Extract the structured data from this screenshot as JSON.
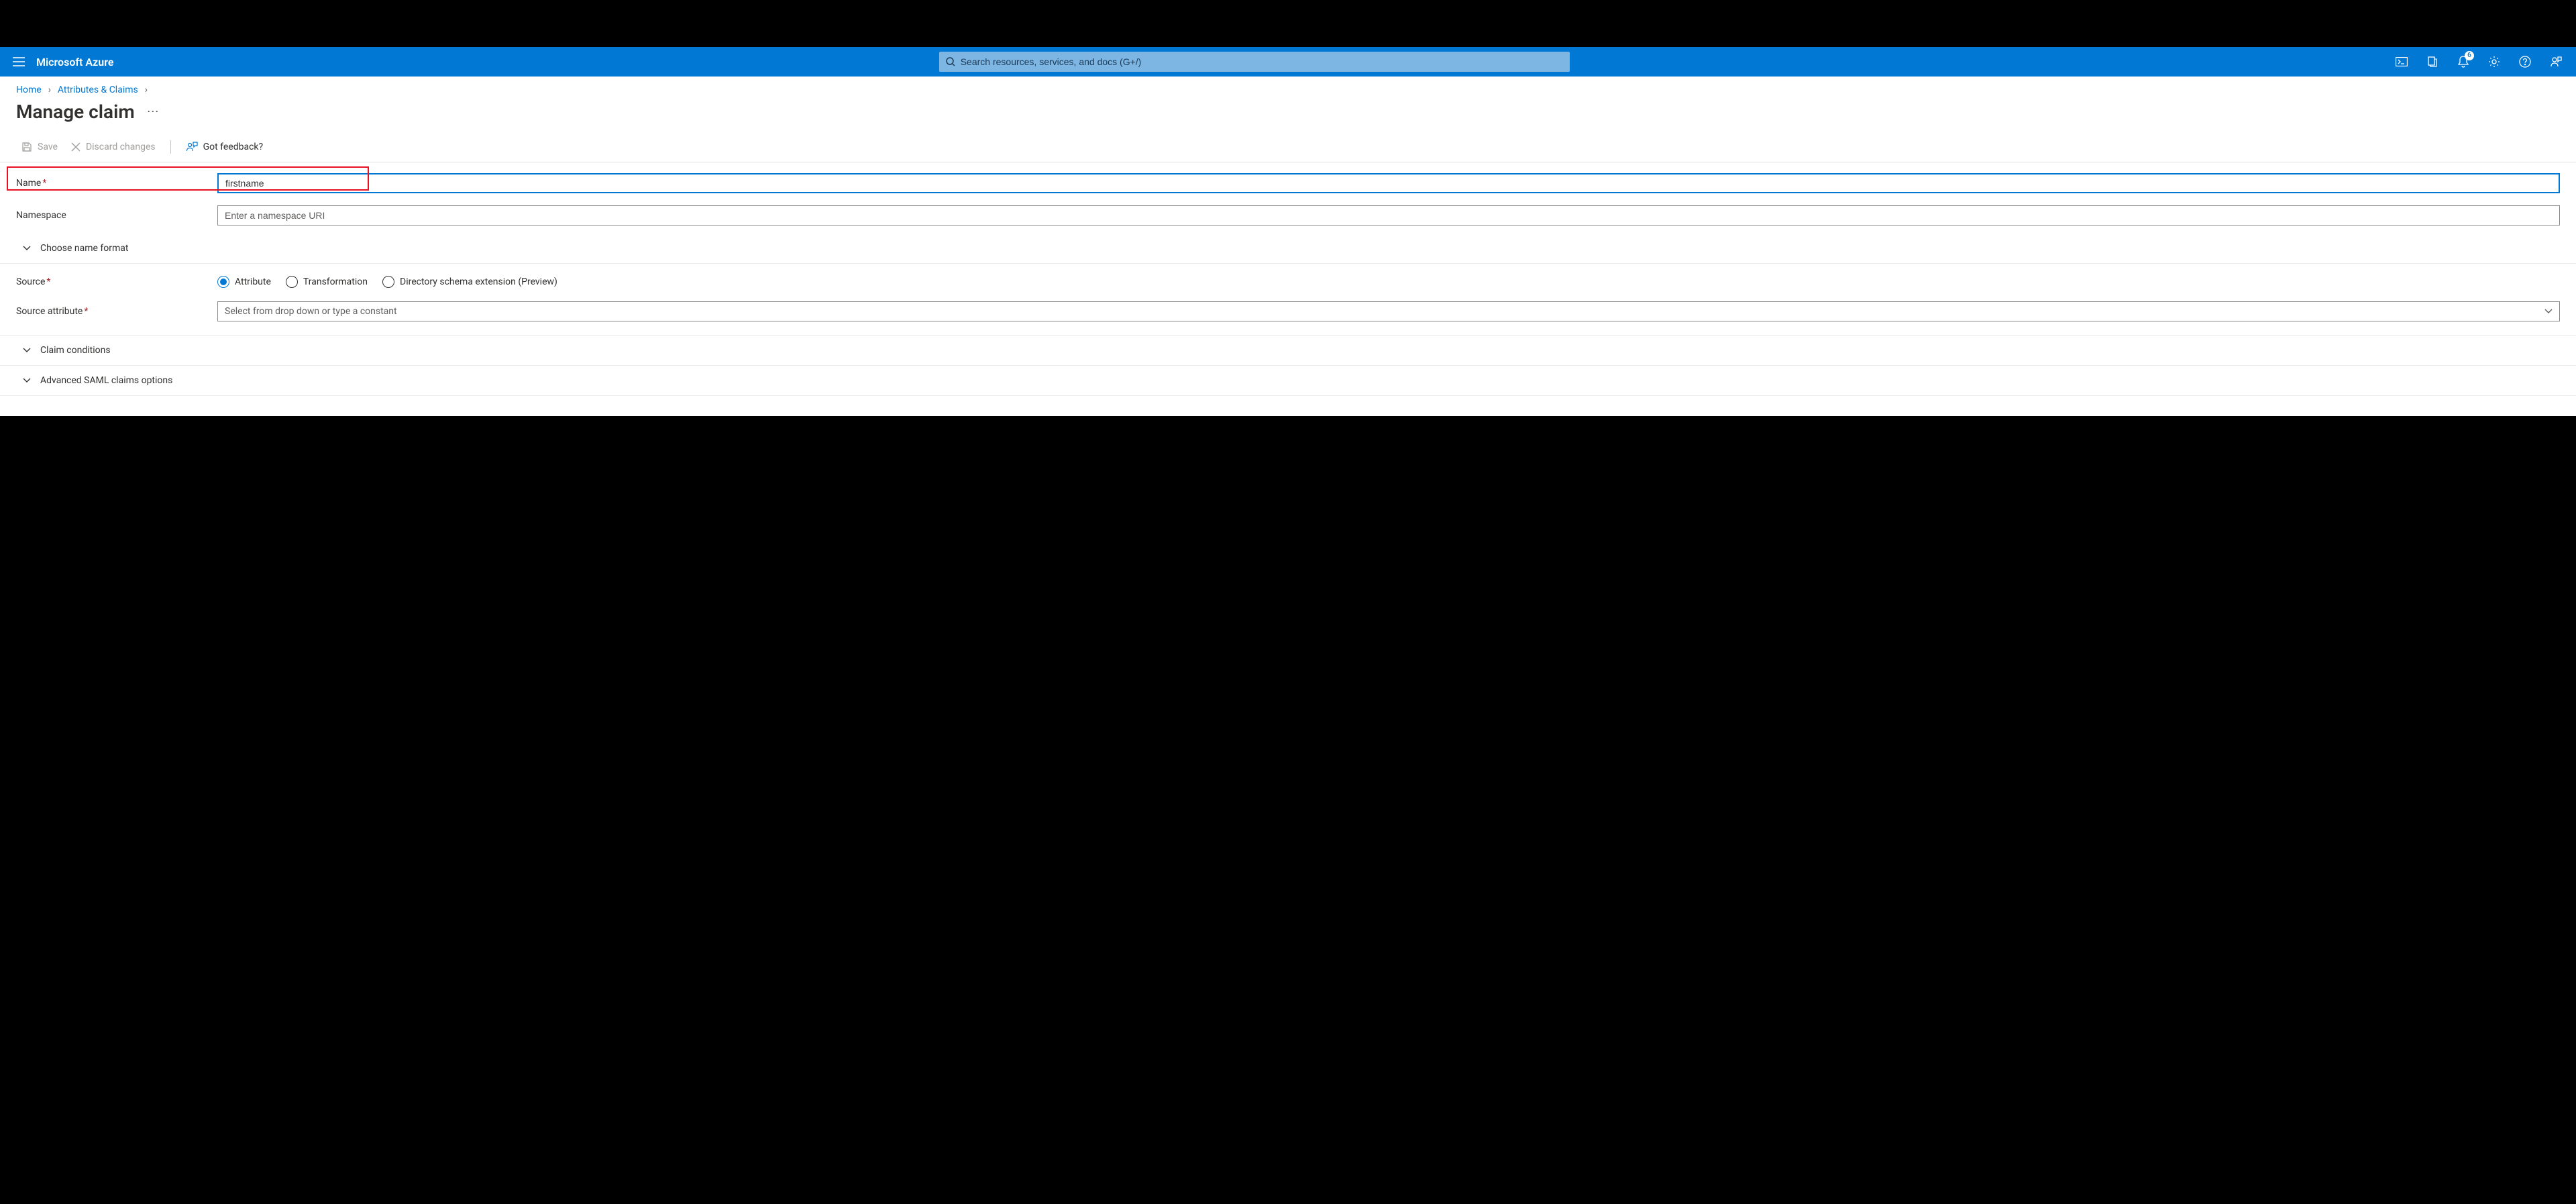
{
  "header": {
    "brand": "Microsoft Azure",
    "search_placeholder": "Search resources, services, and docs (G+/)",
    "notification_count": "6"
  },
  "breadcrumbs": {
    "home": "Home",
    "attrs": "Attributes & Claims"
  },
  "page": {
    "title": "Manage claim"
  },
  "toolbar": {
    "save": "Save",
    "discard": "Discard changes",
    "feedback": "Got feedback?"
  },
  "form": {
    "name_label": "Name",
    "name_value": "firstname",
    "namespace_label": "Namespace",
    "namespace_placeholder": "Enter a namespace URI",
    "choose_format": "Choose name format",
    "source_label": "Source",
    "source_options": {
      "attribute": "Attribute",
      "transformation": "Transformation",
      "directory_ext": "Directory schema extension (Preview)"
    },
    "source_attr_label": "Source attribute",
    "source_attr_placeholder": "Select from drop down or type a constant",
    "claim_conditions": "Claim conditions",
    "advanced_saml": "Advanced SAML claims options"
  }
}
